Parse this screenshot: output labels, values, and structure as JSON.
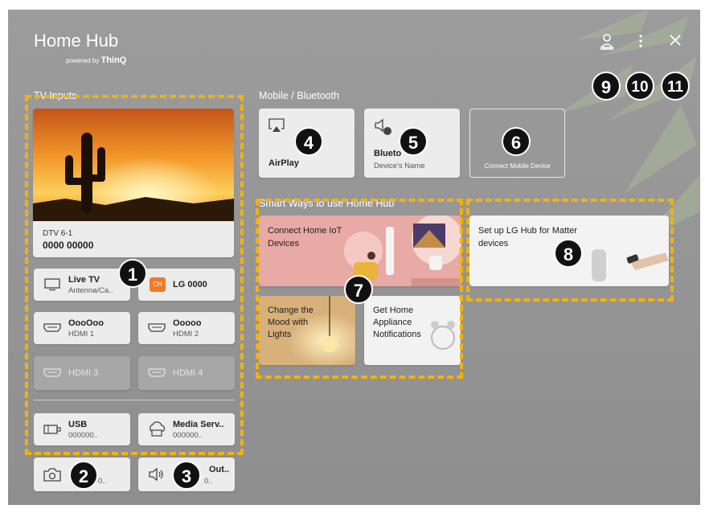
{
  "header": {
    "title": "Home Hub",
    "powered_prefix": "powered by",
    "powered_brand": "ThinQ"
  },
  "sections": {
    "tv_inputs": "TV Inputs",
    "mobile": "Mobile / Bluetooth",
    "smart_ways": "Smart Ways to use Home Hub"
  },
  "tv_preview": {
    "channel": "DTV 6-1",
    "program": "0000 00000"
  },
  "inputs": [
    {
      "name": "Live TV",
      "sub": "Antenna/Ca.."
    },
    {
      "name": "LG 0000",
      "sub": ""
    },
    {
      "name": "OooOoo",
      "sub": "HDMI 1"
    },
    {
      "name": "Ooooo",
      "sub": "HDMI 2"
    },
    {
      "name": "HDMI 3",
      "sub": ""
    },
    {
      "name": "HDMI 4",
      "sub": ""
    }
  ],
  "storage": [
    {
      "name": "USB",
      "sub": "000000.."
    },
    {
      "name": "Media Serv..",
      "sub": "000000.."
    }
  ],
  "extras": [
    {
      "name": "",
      "sub": "0.."
    },
    {
      "name": "Out..",
      "sub": "0.."
    }
  ],
  "mobile": {
    "airplay": "AirPlay",
    "bluetooth_name": "Blueto",
    "bluetooth_sub": "Device's Name",
    "connect": "Connect Mobile Device"
  },
  "smart": {
    "iot": "Connect Home IoT Devices",
    "matter": "Set up LG Hub for Matter devices",
    "mood": "Change the Mood with Lights",
    "appliance": "Get Home Appliance Notifications"
  },
  "badges": [
    "1",
    "2",
    "3",
    "4",
    "5",
    "6",
    "7",
    "8",
    "9",
    "10",
    "11"
  ],
  "colors": {
    "highlight_dash": "#f2b20c",
    "badge_bg": "#111111",
    "background": "#969696",
    "live_tv_dot": "#2ebf4f",
    "lg_channel_icon": "#f07a2a"
  }
}
